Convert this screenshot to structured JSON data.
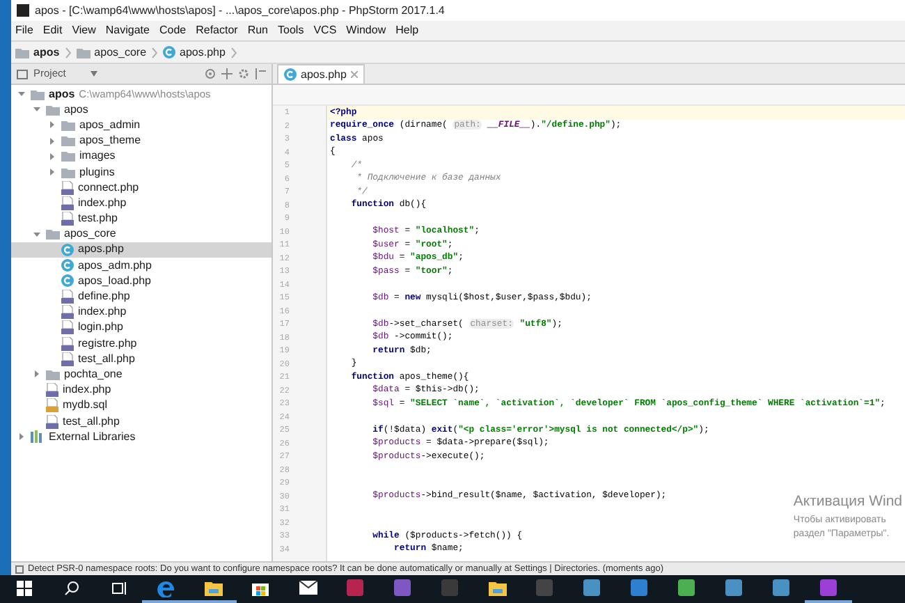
{
  "window": {
    "title": "apos - [C:\\wamp64\\www\\hosts\\apos] - ...\\apos_core\\apos.php - PhpStorm 2017.1.4"
  },
  "menu": [
    "File",
    "Edit",
    "View",
    "Navigate",
    "Code",
    "Refactor",
    "Run",
    "Tools",
    "VCS",
    "Window",
    "Help"
  ],
  "breadcrumbs": [
    {
      "kind": "folder",
      "label": "apos"
    },
    {
      "kind": "folder",
      "label": "apos_core"
    },
    {
      "kind": "class",
      "label": "apos.php"
    }
  ],
  "project_panel": {
    "title": "Project"
  },
  "tabs": [
    {
      "label": "apos.php",
      "selected": true
    }
  ],
  "tree": [
    {
      "kind": "folder",
      "label": "apos",
      "path": "C:\\wamp64\\www\\hosts\\apos",
      "expanded": true,
      "selected": false,
      "children": [
        {
          "kind": "folder",
          "label": "apos",
          "expanded": true,
          "selected": false,
          "children": [
            {
              "kind": "folder",
              "label": "apos_admin",
              "expanded": false,
              "selected": false
            },
            {
              "kind": "folder",
              "label": "apos_theme",
              "expanded": false,
              "selected": false
            },
            {
              "kind": "folder",
              "label": "images",
              "expanded": false,
              "selected": false
            },
            {
              "kind": "folder",
              "label": "plugins",
              "expanded": false,
              "selected": false
            },
            {
              "kind": "php",
              "label": "connect.php",
              "selected": false
            },
            {
              "kind": "php",
              "label": "index.php",
              "selected": false
            },
            {
              "kind": "php",
              "label": "test.php",
              "selected": false
            }
          ]
        },
        {
          "kind": "folder",
          "label": "apos_core",
          "expanded": true,
          "selected": false,
          "children": [
            {
              "kind": "class",
              "label": "apos.php",
              "selected": true
            },
            {
              "kind": "class",
              "label": "apos_adm.php",
              "selected": false
            },
            {
              "kind": "class",
              "label": "apos_load.php",
              "selected": false
            },
            {
              "kind": "php",
              "label": "define.php",
              "selected": false
            },
            {
              "kind": "php",
              "label": "index.php",
              "selected": false
            },
            {
              "kind": "php",
              "label": "login.php",
              "selected": false
            },
            {
              "kind": "php",
              "label": "registre.php",
              "selected": false
            },
            {
              "kind": "php",
              "label": "test_all.php",
              "selected": false
            }
          ]
        },
        {
          "kind": "folder",
          "label": "pochta_one",
          "expanded": false,
          "selected": false
        },
        {
          "kind": "php",
          "label": "index.php",
          "selected": false
        },
        {
          "kind": "sql",
          "label": "mydb.sql",
          "selected": false
        },
        {
          "kind": "php",
          "label": "test_all.php",
          "selected": false
        }
      ]
    },
    {
      "kind": "library",
      "label": "External Libraries",
      "expanded": false,
      "selected": false
    }
  ],
  "code": [
    {
      "number": "1",
      "current": true,
      "segments": [
        {
          "kind": "kw",
          "text": "<?php"
        }
      ]
    },
    {
      "number": "2",
      "current": false,
      "segments": [
        {
          "kind": "kw",
          "text": "require_once"
        },
        {
          "kind": "plain",
          "text": " (dirname( "
        },
        {
          "kind": "hint",
          "text": "path:"
        },
        {
          "kind": "const",
          "text": " __FILE__"
        },
        {
          "kind": "plain",
          "text": ")."
        },
        {
          "kind": "str",
          "text": "\"/define.php\""
        },
        {
          "kind": "plain",
          "text": ");"
        }
      ]
    },
    {
      "number": "3",
      "current": false,
      "segments": [
        {
          "kind": "kw",
          "text": "class"
        },
        {
          "kind": "plain",
          "text": " apos"
        }
      ]
    },
    {
      "number": "4",
      "current": false,
      "segments": [
        {
          "kind": "plain",
          "text": "{"
        }
      ]
    },
    {
      "number": "5",
      "current": false,
      "segments": [
        {
          "kind": "comment",
          "text": "    /*"
        }
      ]
    },
    {
      "number": "6",
      "current": false,
      "segments": [
        {
          "kind": "comment",
          "text": "     * Подключение к базе данных"
        }
      ]
    },
    {
      "number": "7",
      "current": false,
      "segments": [
        {
          "kind": "comment",
          "text": "     */"
        }
      ]
    },
    {
      "number": "8",
      "current": false,
      "segments": [
        {
          "kind": "kw",
          "text": "    function"
        },
        {
          "kind": "plain",
          "text": " db(){"
        }
      ]
    },
    {
      "number": "9",
      "current": false
    },
    {
      "number": "10",
      "current": false,
      "segments": [
        {
          "kind": "var",
          "text": "        $host"
        },
        {
          "kind": "plain",
          "text": " = "
        },
        {
          "kind": "str",
          "text": "\"localhost\""
        },
        {
          "kind": "plain",
          "text": ";"
        }
      ]
    },
    {
      "number": "11",
      "current": false,
      "segments": [
        {
          "kind": "var",
          "text": "        $user"
        },
        {
          "kind": "plain",
          "text": " = "
        },
        {
          "kind": "str",
          "text": "\"root\""
        },
        {
          "kind": "plain",
          "text": ";"
        }
      ]
    },
    {
      "number": "12",
      "current": false,
      "segments": [
        {
          "kind": "var",
          "text": "        $bdu"
        },
        {
          "kind": "plain",
          "text": " = "
        },
        {
          "kind": "str",
          "text": "\"apos_db\""
        },
        {
          "kind": "plain",
          "text": ";"
        }
      ]
    },
    {
      "number": "13",
      "current": false,
      "segments": [
        {
          "kind": "var",
          "text": "        $pass"
        },
        {
          "kind": "plain",
          "text": " = "
        },
        {
          "kind": "str",
          "text": "\"toor\""
        },
        {
          "kind": "plain",
          "text": ";"
        }
      ]
    },
    {
      "number": "14",
      "current": false
    },
    {
      "number": "15",
      "current": false,
      "segments": [
        {
          "kind": "var",
          "text": "        $db"
        },
        {
          "kind": "plain",
          "text": " = "
        },
        {
          "kind": "kw",
          "text": "new"
        },
        {
          "kind": "plain",
          "text": " mysqli($host,$user,$pass,$bdu);"
        }
      ]
    },
    {
      "number": "16",
      "current": false
    },
    {
      "number": "17",
      "current": false,
      "segments": [
        {
          "kind": "var",
          "text": "        $db"
        },
        {
          "kind": "plain",
          "text": "->set_charset( "
        },
        {
          "kind": "hint",
          "text": "charset:"
        },
        {
          "kind": "str",
          "text": " \"utf8\""
        },
        {
          "kind": "plain",
          "text": ");"
        }
      ]
    },
    {
      "number": "18",
      "current": false,
      "segments": [
        {
          "kind": "var",
          "text": "        $db"
        },
        {
          "kind": "plain",
          "text": " ->commit();"
        }
      ]
    },
    {
      "number": "19",
      "current": false,
      "segments": [
        {
          "kind": "kw",
          "text": "        return"
        },
        {
          "kind": "plain",
          "text": " $db;"
        }
      ]
    },
    {
      "number": "20",
      "current": false,
      "segments": [
        {
          "kind": "plain",
          "text": "    }"
        }
      ]
    },
    {
      "number": "21",
      "current": false,
      "segments": [
        {
          "kind": "kw",
          "text": "    function"
        },
        {
          "kind": "plain",
          "text": " apos_theme(){"
        }
      ]
    },
    {
      "number": "22",
      "current": false,
      "segments": [
        {
          "kind": "var",
          "text": "        $data"
        },
        {
          "kind": "plain",
          "text": " = $this->db();"
        }
      ]
    },
    {
      "number": "23",
      "current": false,
      "segments": [
        {
          "kind": "var",
          "text": "        $sql"
        },
        {
          "kind": "plain",
          "text": " = "
        },
        {
          "kind": "str",
          "text": "\"SELECT `name`, `activation`, `developer` FROM `apos_config_theme` WHERE `activation`=1\""
        },
        {
          "kind": "plain",
          "text": ";"
        }
      ]
    },
    {
      "number": "24",
      "current": false
    },
    {
      "number": "25",
      "current": false,
      "segments": [
        {
          "kind": "kw",
          "text": "        if"
        },
        {
          "kind": "plain",
          "text": "(!$data) "
        },
        {
          "kind": "kw",
          "text": "exit"
        },
        {
          "kind": "plain",
          "text": "("
        },
        {
          "kind": "str",
          "text": "\"<p class='error'>mysql is not connected</p>\""
        },
        {
          "kind": "plain",
          "text": ");"
        }
      ]
    },
    {
      "number": "26",
      "current": false,
      "segments": [
        {
          "kind": "var",
          "text": "        $products"
        },
        {
          "kind": "plain",
          "text": " = $data->prepare($sql);"
        }
      ]
    },
    {
      "number": "27",
      "current": false,
      "segments": [
        {
          "kind": "var",
          "text": "        $products"
        },
        {
          "kind": "plain",
          "text": "->execute();"
        }
      ]
    },
    {
      "number": "28",
      "current": false
    },
    {
      "number": "29",
      "current": false
    },
    {
      "number": "30",
      "current": false,
      "segments": [
        {
          "kind": "var",
          "text": "        $products"
        },
        {
          "kind": "plain",
          "text": "->bind_result($name, $activation, $developer);"
        }
      ]
    },
    {
      "number": "31",
      "current": false
    },
    {
      "number": "32",
      "current": false
    },
    {
      "number": "33",
      "current": false,
      "segments": [
        {
          "kind": "kw",
          "text": "        while"
        },
        {
          "kind": "plain",
          "text": " ($products->fetch()) {"
        }
      ]
    },
    {
      "number": "34",
      "current": false,
      "segments": [
        {
          "kind": "kw",
          "text": "            return"
        },
        {
          "kind": "plain",
          "text": " $name;"
        }
      ]
    }
  ],
  "activation_notice": {
    "title": "Активация Wind",
    "line_1": "Чтобы активировать",
    "line_2": "раздел \"Параметры\"."
  },
  "status_bar": {
    "message": "Detect PSR-0 namespace roots: Do you want to configure namespace roots? It can be done automatically or manually at Settings | Directories. (moments ago)"
  },
  "taskbar": [
    {
      "kind": "start",
      "running": false
    },
    {
      "kind": "search",
      "running": false
    },
    {
      "kind": "taskview",
      "running": false
    },
    {
      "kind": "edge",
      "running": true
    },
    {
      "kind": "explorer",
      "running": true
    },
    {
      "kind": "store",
      "running": false
    },
    {
      "kind": "mail",
      "running": false
    },
    {
      "kind": "access",
      "running": false
    },
    {
      "kind": "studio",
      "running": false
    },
    {
      "kind": "terminal",
      "running": false
    },
    {
      "kind": "folder",
      "running": false
    },
    {
      "kind": "calculator",
      "running": false
    },
    {
      "kind": "app",
      "running": false
    },
    {
      "kind": "globe",
      "running": false
    },
    {
      "kind": "chart",
      "running": false
    },
    {
      "kind": "app",
      "running": false
    },
    {
      "kind": "app",
      "running": false
    },
    {
      "kind": "phpstorm",
      "running": true
    }
  ]
}
